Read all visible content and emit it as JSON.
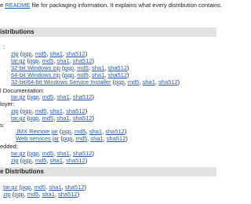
{
  "intro": {
    "prefix": "e ",
    "readme_link": "README",
    "suffix": " file for packaging information. It explains what every distribution contains."
  },
  "binary_section": {
    "title": "istributions"
  },
  "core_label": ":",
  "core_items": [
    {
      "name": "zip",
      "sigs": [
        "pgp",
        "md5",
        "sha1",
        "sha512"
      ]
    },
    {
      "name": "tar.gz",
      "sigs": [
        "pgp",
        "md5",
        "sha1",
        "sha512"
      ]
    },
    {
      "name": "32-bit Windows zip",
      "sigs": [
        "pgp",
        "md5",
        "sha1",
        "sha512"
      ]
    },
    {
      "name": "64-bit Windows zip",
      "sigs": [
        "pgp",
        "md5",
        "sha1",
        "sha512"
      ]
    },
    {
      "name": "32-bit/64-bit Windows Service Installer",
      "sigs": [
        "pgp",
        "md5",
        "sha1",
        "sha512"
      ]
    }
  ],
  "docs_label": "l Documentation:",
  "docs_items": [
    {
      "name": "tar.gz",
      "sigs": [
        "pgp",
        "md5",
        "sha1",
        "sha512"
      ]
    }
  ],
  "deployer_label": "loyer:",
  "deployer_items": [
    {
      "name": "zip",
      "sigs": [
        "pgp",
        "md5",
        "sha1",
        "sha512"
      ]
    },
    {
      "name": "tar.gz",
      "sigs": [
        "pgp",
        "md5",
        "sha1",
        "sha512"
      ]
    }
  ],
  "extras_label": "s:",
  "extras_items": [
    {
      "name": "JMX Remote jar",
      "sigs": [
        "pgp",
        "md5",
        "sha1",
        "sha512"
      ]
    },
    {
      "name": "Web services jar",
      "sigs": [
        "pgp",
        "md5",
        "sha1",
        "sha512"
      ]
    }
  ],
  "embedded_label": "edded:",
  "embedded_items": [
    {
      "name": "tar.gz",
      "sigs": [
        "pgp",
        "md5",
        "sha1",
        "sha512"
      ]
    },
    {
      "name": "zip",
      "sigs": [
        "pgp",
        "md5",
        "sha1",
        "sha512"
      ]
    }
  ],
  "source_section": {
    "title": "e Distributions"
  },
  "source_items": [
    {
      "name": "tar.gz",
      "sigs": [
        "pgp",
        "md5",
        "sha1",
        "sha512"
      ]
    },
    {
      "name": "zip",
      "sigs": [
        "pgp",
        "md5",
        "sha1",
        "sha512"
      ]
    }
  ],
  "punct": {
    "open": " (",
    "close": ")",
    "sep": ", "
  },
  "colors": {
    "link": "#2a5db0",
    "section_bg": "#e2e2e2",
    "text": "#222222"
  }
}
